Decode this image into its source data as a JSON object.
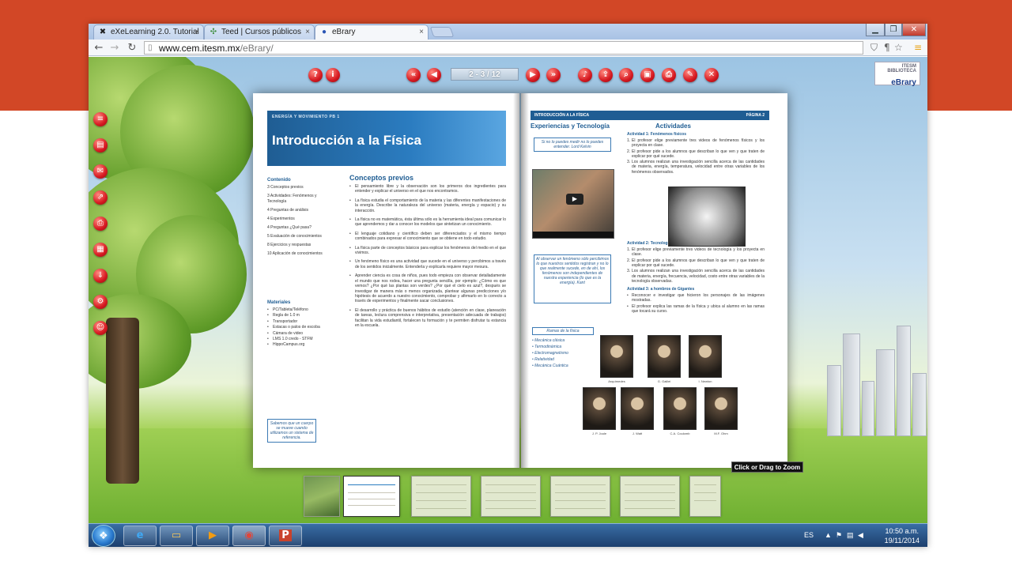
{
  "browser": {
    "tabs": [
      {
        "title": "eXeLearning 2.0. Tutorial",
        "icon": "exe-icon"
      },
      {
        "title": "Teed | Cursos públicos",
        "icon": "teed-icon"
      },
      {
        "title": "eBrary",
        "icon": "ebrary-favicon",
        "active": true
      }
    ],
    "close_glyph": "×",
    "url_host": "www.cem.itesm.mx",
    "url_path": "/eBrary/"
  },
  "viewer": {
    "page_counter": "2 - 3 / 12",
    "logo_small": "ITESM BIBLIOTECA",
    "logo_name": "eBrary",
    "zoom_tooltip": "Click or Drag to Zoom",
    "top_buttons_left": [
      "help-icon",
      "info-icon"
    ],
    "top_buttons_nav": [
      "first-page-icon",
      "prev-page-icon",
      "next-page-icon",
      "last-page-icon"
    ],
    "top_buttons_tools": [
      "audio-icon",
      "share-icon",
      "search-icon",
      "save-icon",
      "print-icon",
      "edit-icon",
      "close-icon"
    ],
    "side_buttons": [
      "menu-icon",
      "bookmark-icon",
      "mail-icon",
      "export-icon",
      "print-icon",
      "pdf-icon",
      "download-icon",
      "settings-icon",
      "user-icon"
    ]
  },
  "left_page": {
    "section": "ENERGÍA Y MOVIMIENTO    PB 1",
    "title": "Introducción a la Física",
    "contenido_heading": "Contenido",
    "contenido_items": [
      "3    Conceptos previos",
      "3    Actividades: Fenómenos y Tecnología",
      "4    Preguntas de análisis",
      "4    Experimentos",
      "4    Preguntas ¿Qué pasa?",
      "5    Evaluación de conocimientos",
      "8    Ejercicios y respuestas",
      "10  Aplicación de conocimientos"
    ],
    "conceptos_heading": "Conceptos previos",
    "bullets": [
      "El pensamiento libre y la observación son los primeros dos ingredientes para entender y explicar el universo en el que nos encontramos.",
      "La física estudia el comportamiento de la materia y las diferentes manifestaciones de la energía. Describe la naturaleza del universo (materia, energía y espacio) y su interacción.",
      "La física no es matemática, ésta última sólo es la herramienta ideal para comunicar lo que aprendemos y dar a conocer los modelos que sintetizan un conocimiento.",
      "El lenguaje cotidiano y científico deben ser diferenciados y el mismo tiempo combinados para expresar el conocimiento que se obtiene en todo estudio.",
      "La física parte de conceptos básicos para explicar los fenómenos del medio en el que vivimos.",
      "Un fenómeno físico es una actividad que sucede en el universo y percibimos a través de los sentidos inicialmente. Entenderla y explicarla requiere mayor mesura.",
      "Aprender ciencia es cosa de niños, pues todo empieza con observar detalladamente el mundo que nos rodea, hacer una pregunta sencilla, por ejemplo: ¿Cómo es que vemos? ¿Por qué las plantas son verdes? ¿Por qué el cielo es azul?, después se investigar de manera más o menos organizada, plantear algunas predicciones y/o hipótesis de acuerdo a nuestro conocimiento, comprobar y afirmarlo en lo correcto a través de experimentos y finalmente sacar conclusiones.",
      "El desarrollo y práctica de buenos hábitos de estudio (atención en clase, planeación de tareas, lectura comprensiva e interpretativa, presentación adecuada de trabajos) facilitan la vida estudiantil, fortalecen tu formación y te permiten disfrutar tu estancia en la escuela."
    ],
    "materiales_heading": "Materiales",
    "materiales": [
      "PC/Tableta/Teléfono",
      "Regla de 1.0 m",
      "Transportador",
      "Estacas o palos de escoba",
      "Cámara de video",
      "LMS 1.0 credo - STFM",
      "HippoCampus.org"
    ],
    "note": "Sabemos que un cuerpo se mueve cuando utilizamos un sistema de referencia."
  },
  "right_page": {
    "header": "INTRODUCCIÓN A LA FÍSICA",
    "page_label": "PÁGINA 2",
    "exp_heading": "Experiencias y Tecnología",
    "act_heading": "Actividades",
    "quote1": "Si no lo puedes medir no lo puedes entender. Lord Kelvin",
    "quote2": "Al observar un fenómeno sólo percibimos lo que nuestros sentidos registran y no lo que realmente sucede, en de ahí, los fenómenos son independientes de nuestra experiencia (lo que es la energía). Kant",
    "ramas_title": "Ramas de la física",
    "ramas": [
      "Mecánica clásica",
      "Termodinámica",
      "Electromagnetismo",
      "Relatividad",
      "Mecánica Cuántica"
    ],
    "act1_title": "Actividad 1: Fenómenos físicos",
    "act1_items": [
      "El profesor elige previamente tres videos de fenómenos físicos y los proyecta en clase.",
      "El profesor pide a los alumnos que describan lo que ven y que traten de explicar por qué sucede.",
      "Los alumnos realizan una investigación sencilla acerca de las cantidades de materia, energía, temperatura, velocidad entre otras variables de los fenómenos observados."
    ],
    "act2_title": "Actividad 2: Tecnología",
    "act2_items": [
      "El profesor elige previamente tres videos de tecnología y los proyecta en clase.",
      "El profesor pide a los alumnos que describan lo que ven y que traten de explicar por qué sucede.",
      "Los alumnos realizan una investigación sencilla acerca de las cantidades de materia, energía, frecuencia, velocidad, costo entre otras variables de la tecnología observadas."
    ],
    "act3_title": "Actividad 3: a hombros de Gigantes",
    "act3_items": [
      "Reconocer e investigar que hicieron los personajes de las imágenes mostradas.",
      "El profesor explica las ramas de la física y ubica al alumno en las ramas que tocará su curso."
    ],
    "portraits": [
      "Arquímedes",
      "G. Galilei",
      "I. Newton",
      "J. P. Joule",
      "J. Watt",
      "C.A. Coulomb",
      "M.F. Ohm"
    ]
  },
  "taskbar": {
    "apps": [
      "ie-icon",
      "explorer-icon",
      "media-player-icon",
      "chrome-icon",
      "powerpoint-icon"
    ],
    "lang": "ES",
    "time": "10:50 a.m.",
    "date": "19/11/2014"
  }
}
